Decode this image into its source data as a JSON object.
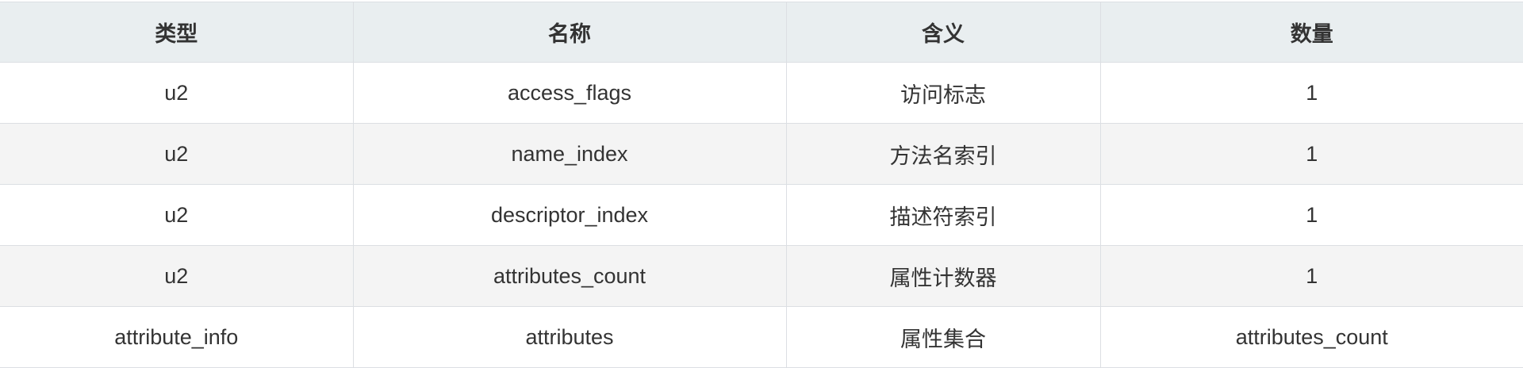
{
  "table": {
    "headers": [
      "类型",
      "名称",
      "含义",
      "数量"
    ],
    "rows": [
      [
        "u2",
        "access_flags",
        "访问标志",
        "1"
      ],
      [
        "u2",
        "name_index",
        "方法名索引",
        "1"
      ],
      [
        "u2",
        "descriptor_index",
        "描述符索引",
        "1"
      ],
      [
        "u2",
        "attributes_count",
        "属性计数器",
        "1"
      ],
      [
        "attribute_info",
        "attributes",
        "属性集合",
        "attributes_count"
      ]
    ]
  }
}
